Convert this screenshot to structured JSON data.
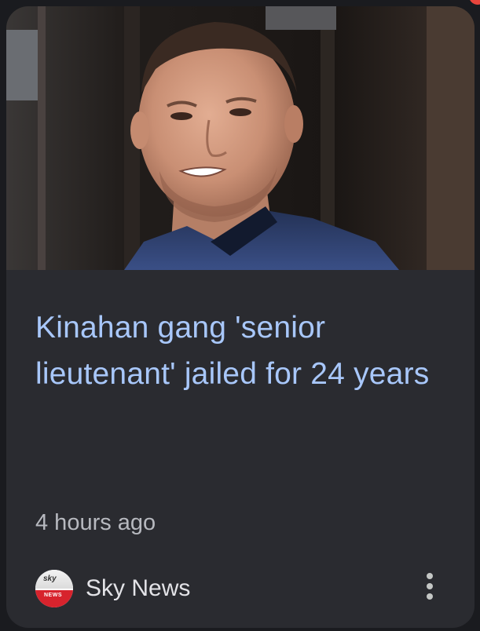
{
  "article": {
    "image_alt": "Man in dark jacket outdoors",
    "headline": "Kinahan gang 'senior lieutenant' jailed for 24 years",
    "timestamp": "4 hours ago",
    "source": {
      "name": "Sky News",
      "logo_icon": "sky-news-logo-icon",
      "logo_text_top": "sky",
      "logo_text_bottom": "NEWS"
    },
    "more_icon": "more-vert-icon"
  },
  "colors": {
    "card_bg": "#2a2b30",
    "headline": "#a8c7fa",
    "meta_text": "#b7b9bf",
    "source_text": "#e3e3e7",
    "notification_dot": "#e8453c"
  }
}
